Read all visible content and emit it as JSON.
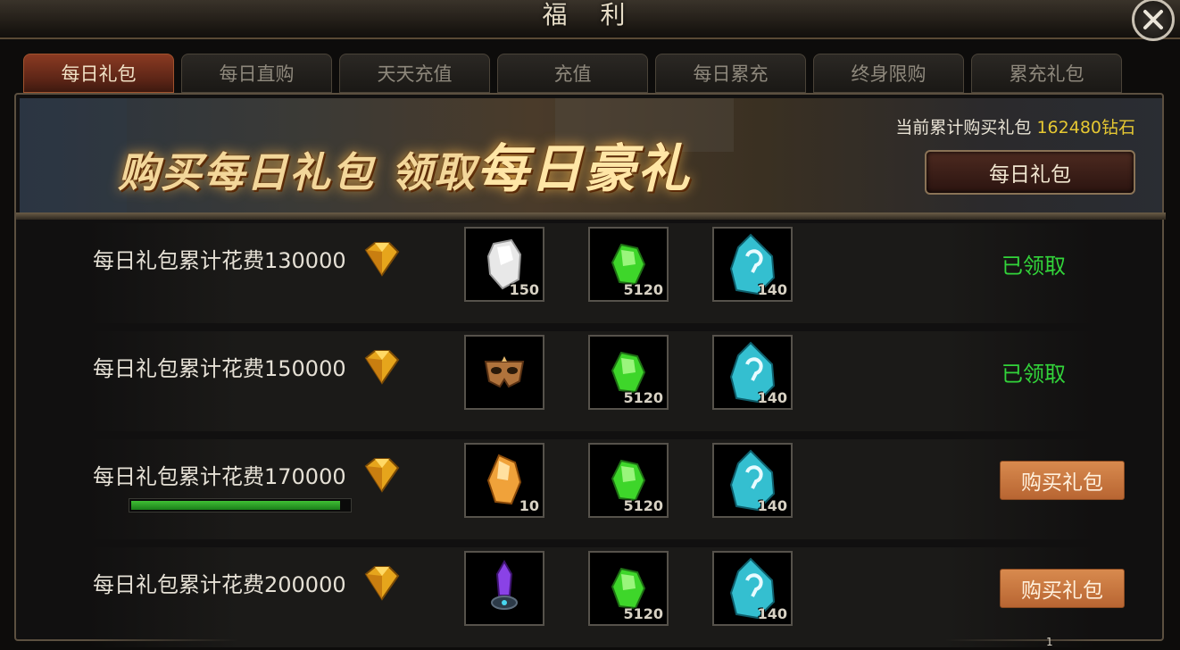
{
  "window": {
    "title": "福 利",
    "close_icon": "close-icon"
  },
  "tabs": [
    {
      "label": "每日礼包",
      "active": true
    },
    {
      "label": "每日直购",
      "active": false
    },
    {
      "label": "天天充值",
      "active": false
    },
    {
      "label": "充值",
      "active": false
    },
    {
      "label": "每日累充",
      "active": false
    },
    {
      "label": "终身限购",
      "active": false
    },
    {
      "label": "累充礼包",
      "active": false
    }
  ],
  "banner": {
    "slogan_part1": "购买每日礼包 领取",
    "slogan_part2": "每日豪礼",
    "accum_label": "当前累计购买礼包",
    "accum_value": "162480钻石",
    "package_button": "每日礼包"
  },
  "rows": [
    {
      "label": "每日礼包累计花费130000",
      "items": [
        {
          "icon": "white-stone-icon",
          "count": "150"
        },
        {
          "icon": "green-gem-icon",
          "count": "5120"
        },
        {
          "icon": "blue-rune-stone-icon",
          "count": "140"
        }
      ],
      "status": "已领取"
    },
    {
      "label": "每日礼包累计花费150000",
      "items": [
        {
          "icon": "golden-mask-icon",
          "count": ""
        },
        {
          "icon": "green-gem-icon",
          "count": "5120"
        },
        {
          "icon": "blue-rune-stone-icon",
          "count": "140"
        }
      ],
      "status": "已领取"
    },
    {
      "label": "每日礼包累计花费170000",
      "items": [
        {
          "icon": "orange-crystal-icon",
          "count": "10"
        },
        {
          "icon": "green-gem-icon",
          "count": "5120"
        },
        {
          "icon": "blue-rune-stone-icon",
          "count": "140"
        }
      ],
      "progress": 0.96,
      "button": "购买礼包"
    },
    {
      "label": "每日礼包累计花费200000",
      "items": [
        {
          "icon": "purple-crystal-pedestal-icon",
          "count": ""
        },
        {
          "icon": "green-gem-icon",
          "count": "5120"
        },
        {
          "icon": "blue-rune-stone-icon",
          "count": "140"
        }
      ],
      "button": "购买礼包"
    }
  ],
  "page_number": "1",
  "colors": {
    "accent_tab": "#8a3a22",
    "claimed": "#32d43a",
    "buy_button": "#c9773f",
    "diamond": "#e6c832"
  }
}
